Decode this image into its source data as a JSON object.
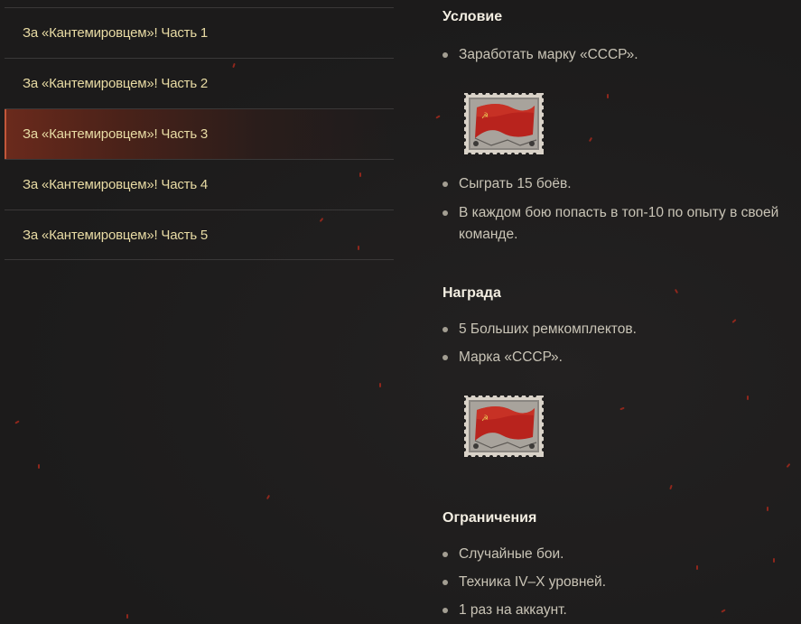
{
  "menu": {
    "items": [
      {
        "label": "За «Кантемировцем»! Часть 1",
        "active": false
      },
      {
        "label": "За «Кантемировцем»! Часть 2",
        "active": false
      },
      {
        "label": "За «Кантемировцем»! Часть 3",
        "active": true
      },
      {
        "label": "За «Кантемировцем»! Часть 4",
        "active": false
      },
      {
        "label": "За «Кантемировцем»! Часть 5",
        "active": false
      }
    ]
  },
  "condition": {
    "title": "Условие",
    "items": [
      "Заработать марку «СССР».",
      "Сыграть 15 боёв.",
      "В каждом бою попасть в топ-10 по опыту в своей команде."
    ]
  },
  "reward": {
    "title": "Награда",
    "items": [
      "5 Больших ремкомплектов.",
      "Марка «СССР»."
    ]
  },
  "restrictions": {
    "title": "Ограничения",
    "items": [
      "Случайные бои.",
      "Техника IV–X уровней.",
      "1 раз на аккаунт."
    ]
  },
  "icons": {
    "stamp": "ussr-flag-stamp-icon",
    "bullet": "bullet-dot-icon"
  },
  "colors": {
    "background": "#1f1e1e",
    "menu_text": "#e8dba4",
    "active_accent": "#c2573a",
    "title_text": "#f3eee2",
    "body_text": "#c9c4b6",
    "flag_red": "#b8231d"
  }
}
